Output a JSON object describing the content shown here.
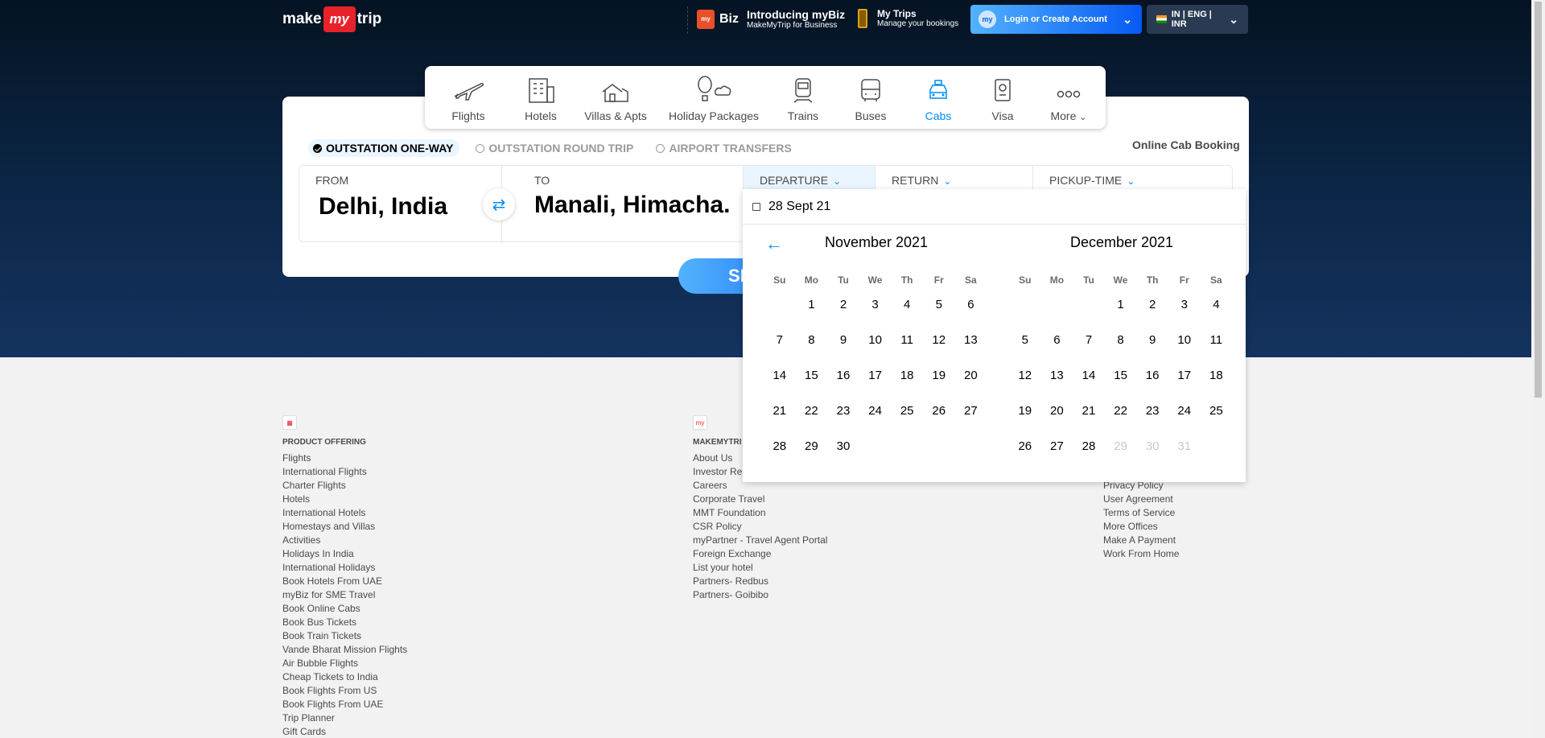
{
  "header": {
    "logo": {
      "make": "make",
      "my": "my",
      "trip": "trip"
    },
    "mybiz": {
      "badge": "my",
      "label": "Biz",
      "title": "Introducing myBiz",
      "subtitle": "MakeMyTrip for Business"
    },
    "mytrips": {
      "title": "My Trips",
      "subtitle": "Manage your bookings"
    },
    "login": {
      "label": "Login or Create Account"
    },
    "lang": {
      "label": "IN | ENG | INR"
    }
  },
  "tabs": [
    {
      "label": "Flights",
      "icon": "plane-icon"
    },
    {
      "label": "Hotels",
      "icon": "building-icon"
    },
    {
      "label": "Villas & Apts",
      "icon": "house-icon"
    },
    {
      "label": "Holiday Packages",
      "icon": "balloon-icon"
    },
    {
      "label": "Trains",
      "icon": "train-icon"
    },
    {
      "label": "Buses",
      "icon": "bus-icon"
    },
    {
      "label": "Cabs",
      "icon": "cab-icon",
      "active": true
    },
    {
      "label": "Visa",
      "icon": "passport-icon"
    },
    {
      "label": "More",
      "icon": "more-icon"
    }
  ],
  "trip_types": [
    {
      "label": "OUTSTATION ONE-WAY",
      "selected": true
    },
    {
      "label": "OUTSTATION ROUND TRIP",
      "selected": false
    },
    {
      "label": "AIRPORT TRANSFERS",
      "selected": false
    }
  ],
  "online_cab_booking": "Online Cab Booking",
  "form": {
    "from_label": "FROM",
    "from_value": "Delhi, India",
    "to_label": "TO",
    "to_value": "Manali, Himacha.",
    "departure_label": "DEPARTURE",
    "return_label": "RETURN",
    "pickup_label": "PICKUP-TIME",
    "search_label": "SE"
  },
  "calendar": {
    "selected_date": "28 Sept 21",
    "dow": [
      "Su",
      "Mo",
      "Tu",
      "We",
      "Th",
      "Fr",
      "Sa"
    ],
    "months": [
      {
        "title": "November 2021",
        "offset": 1,
        "days": 30,
        "disabled_from": 31
      },
      {
        "title": "December 2021",
        "offset": 3,
        "days": 31,
        "disabled_from": 29
      }
    ]
  },
  "footer": {
    "col1": {
      "heading": "PRODUCT OFFERING",
      "links": [
        "Flights",
        "International Flights",
        "Charter Flights",
        "Hotels",
        "International Hotels",
        "Homestays and Villas",
        "Activities",
        "Holidays In India",
        "International Holidays",
        "Book Hotels From UAE",
        "myBiz for SME Travel",
        "Book Online Cabs",
        "Book Bus Tickets",
        "Book Train Tickets",
        "Vande Bharat Mission Flights",
        "Air Bubble Flights",
        "Cheap Tickets to India",
        "Book Flights From US",
        "Book Flights From UAE",
        "Trip Planner",
        "Gift Cards"
      ]
    },
    "col2": {
      "heading": "MAKEMYTRI",
      "links": [
        "About Us",
        "Investor Re",
        "Careers",
        "Corporate Travel",
        "MMT Foundation",
        "CSR Policy",
        "myPartner - Travel Agent Portal",
        "Foreign Exchange",
        "List your hotel",
        "Partners- Redbus",
        "Partners- Goibibo"
      ]
    },
    "col3": {
      "links": [
        "Privacy Policy",
        "User Agreement",
        "Terms of Service",
        "More Offices",
        "Make A Payment",
        "Work From Home"
      ]
    }
  }
}
